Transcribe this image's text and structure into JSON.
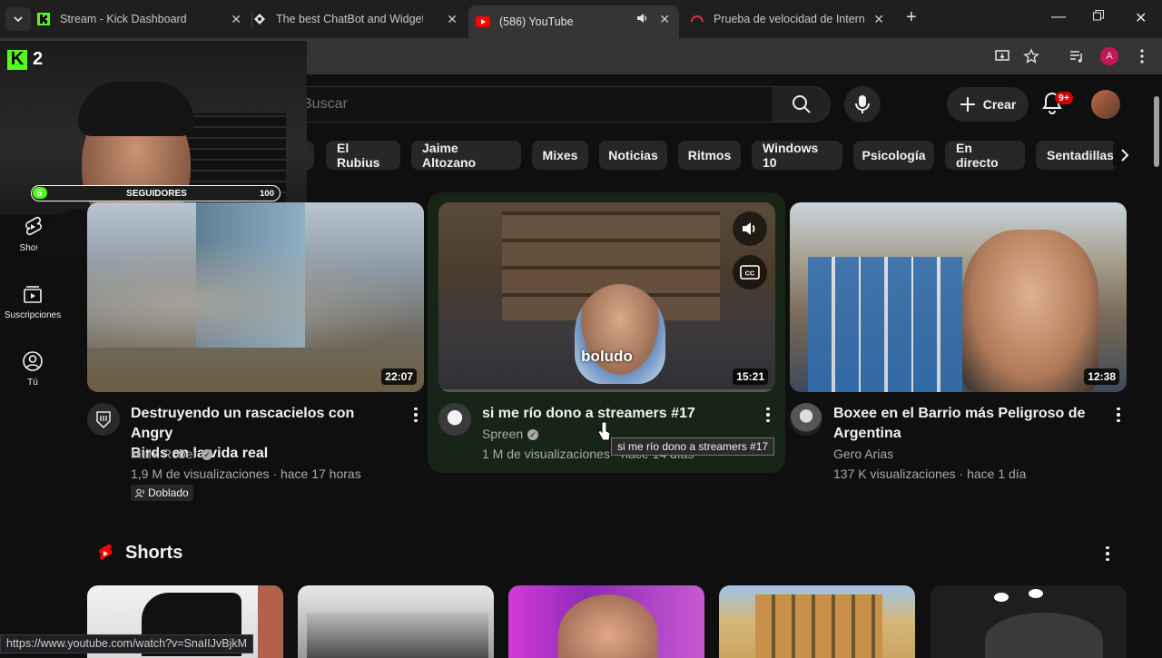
{
  "browser": {
    "tabs": [
      {
        "title": "Stream - Kick Dashboard",
        "icon": "kick-icon"
      },
      {
        "title": "The best ChatBot and Widgets",
        "icon": "streamelements-icon"
      },
      {
        "title": "(586) YouTube",
        "icon": "youtube-icon",
        "active": true
      },
      {
        "title": "Prueba de velocidad de Internet",
        "icon": "speedtest-icon"
      }
    ],
    "profile_initial": "A",
    "status_url": "https://www.youtube.com/watch?v=SnaIIJvBjkM"
  },
  "youtube": {
    "search_placeholder": "Buscar",
    "create_label": "Crear",
    "notifications_badge": "9+",
    "chips": [
      "El Rubius",
      "Jaime Altozano",
      "Mixes",
      "Noticias",
      "Ritmos",
      "Windows 10",
      "Psicología",
      "En directo",
      "Sentadillas"
    ],
    "guide": [
      {
        "label": "Shorts",
        "icon": "shorts-icon"
      },
      {
        "label": "Suscripciones",
        "icon": "subscriptions-icon"
      },
      {
        "label": "Tú",
        "icon": "you-icon"
      }
    ],
    "videos": [
      {
        "title_line1": "Destruyendo un rascacielos con Angry",
        "title_line2": "Birds en la vida real",
        "channel": "Mark Rober",
        "meta": "1,9 M de visualizaciones · hace 17 horas",
        "badge": "Doblado",
        "duration": "22:07"
      },
      {
        "title_line1": "si me río dono a streamers #17",
        "channel": "Spreen",
        "meta": "1 M de visualizaciones · hace 14 días",
        "duration": "15:21",
        "overlay_text": "boludo",
        "tooltip": "si me río dono a streamers #17"
      },
      {
        "title_line1": "Boxee en el Barrio más Peligroso de",
        "title_line2": "Argentina",
        "channel": "Gero Arias",
        "meta": "137 K visualizaciones · hace 1 día",
        "duration": "12:38"
      }
    ],
    "shorts_title": "Shorts"
  },
  "kick_overlay": {
    "count": "2",
    "followers_label": "SEGUIDORES",
    "followers_current": "5",
    "followers_goal": "100",
    "progress_fraction": 0.05
  },
  "colors": {
    "youtube_red": "#ff0000",
    "kick_green": "#53fc18",
    "badge_red": "#cc0000"
  }
}
